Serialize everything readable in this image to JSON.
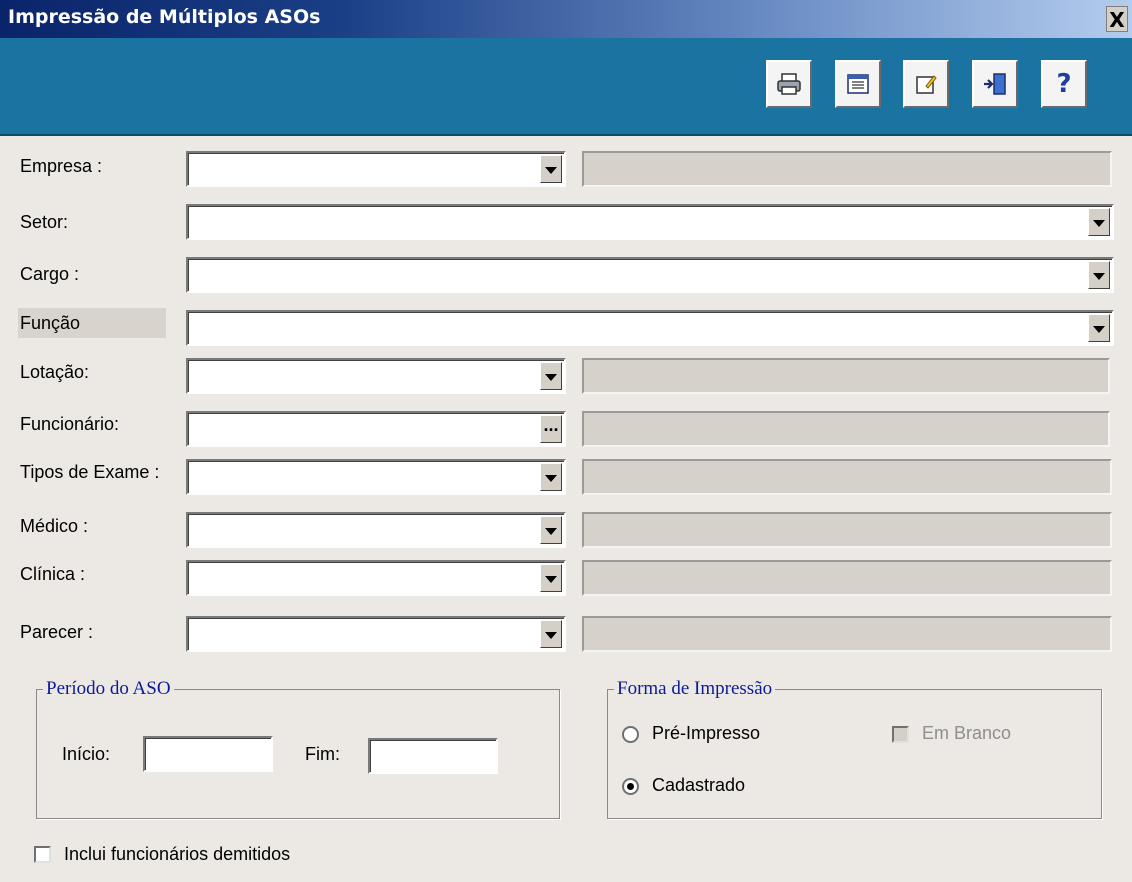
{
  "window": {
    "title": "Impressão de Múltiplos ASOs",
    "close_label": "X"
  },
  "toolbar": {
    "buttons": [
      {
        "name": "print-button",
        "icon": "printer-icon"
      },
      {
        "name": "preview-button",
        "icon": "grid-icon"
      },
      {
        "name": "edit-button",
        "icon": "note-icon"
      },
      {
        "name": "exit-button",
        "icon": "exit-door-icon"
      },
      {
        "name": "help-button",
        "icon": "help-icon",
        "label": "?"
      }
    ]
  },
  "fields": {
    "empresa": {
      "label": "Empresa :",
      "value": "",
      "description": ""
    },
    "setor": {
      "label": "Setor:",
      "value": ""
    },
    "cargo": {
      "label": "Cargo :",
      "value": ""
    },
    "funcao": {
      "label": "Função",
      "value": ""
    },
    "lotacao": {
      "label": "Lotação:",
      "value": "",
      "description": ""
    },
    "funcionario": {
      "label": "Funcionário:",
      "value": "",
      "description": "",
      "button_label": "..."
    },
    "tipos_exame": {
      "label": "Tipos de Exame :",
      "value": "",
      "description": ""
    },
    "medico": {
      "label": "Médico :",
      "value": "",
      "description": ""
    },
    "clinica": {
      "label": "Clínica :",
      "value": "",
      "description": ""
    },
    "parecer": {
      "label": "Parecer :",
      "value": "",
      "description": ""
    }
  },
  "periodo": {
    "legend": "Período do ASO",
    "inicio_label": "Início:",
    "inicio_value": "",
    "fim_label": "Fim:",
    "fim_value": ""
  },
  "forma_impressao": {
    "legend": "Forma de Impressão",
    "pre_impresso_label": "Pré-Impresso",
    "pre_impresso_selected": false,
    "cadastrado_label": "Cadastrado",
    "cadastrado_selected": true,
    "em_branco_label": "Em Branco",
    "em_branco_checked": false,
    "em_branco_enabled": false
  },
  "inclui_demitidos": {
    "label": "Inclui funcionários demitidos",
    "checked": false
  },
  "colors": {
    "toolbar_bg": "#1b73a1",
    "title_bar": "#0a246a",
    "legend_text": "#0a1a9a"
  }
}
